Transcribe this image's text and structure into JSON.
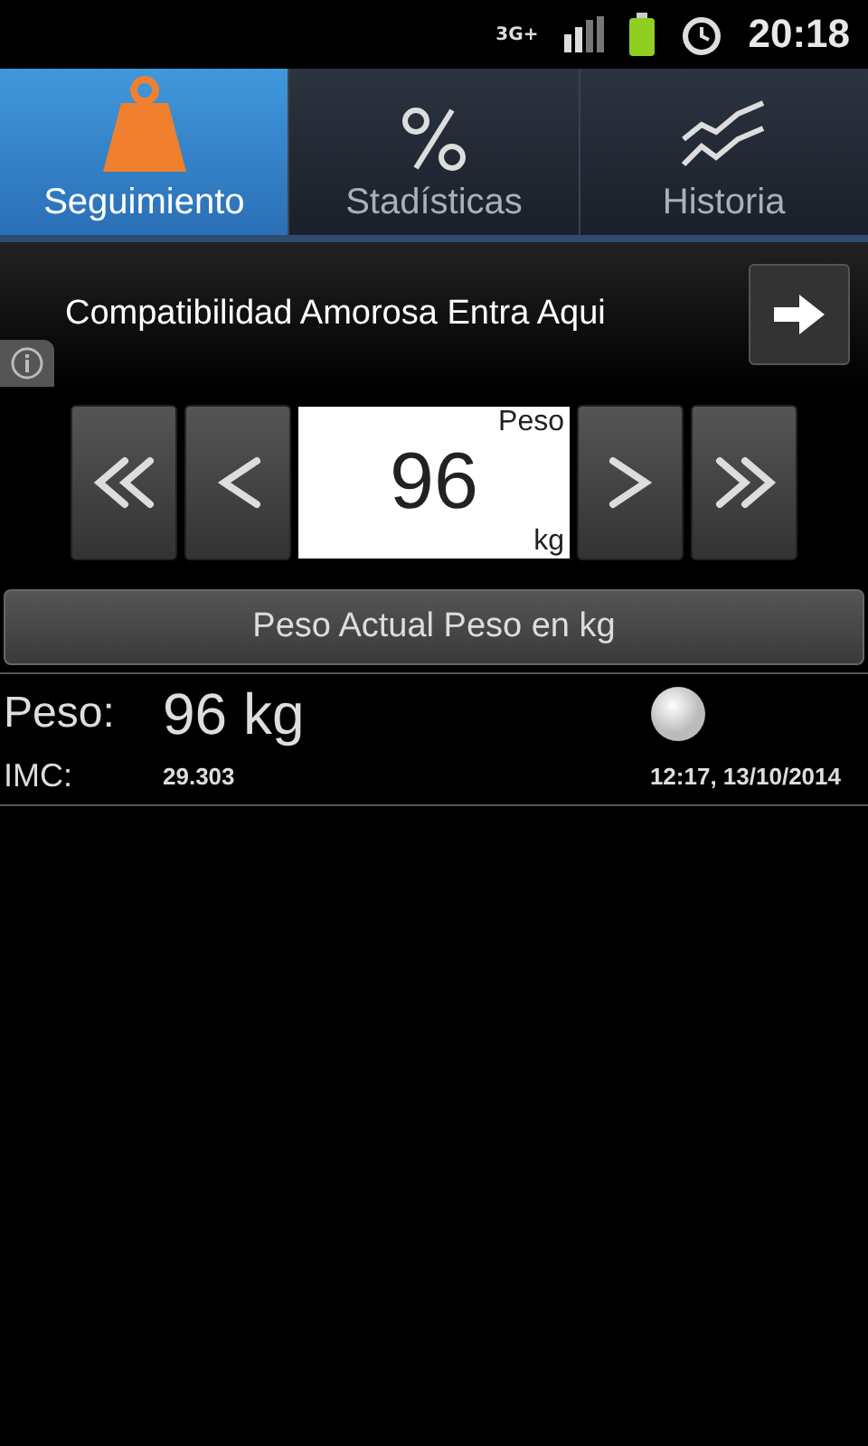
{
  "status_bar": {
    "network": "3G+",
    "time": "20:18"
  },
  "tabs": [
    {
      "label": "Seguimiento",
      "selected": true
    },
    {
      "label": "Stadísticas",
      "selected": false
    },
    {
      "label": "Historia",
      "selected": false
    }
  ],
  "ad": {
    "text": "Compatibilidad Amorosa Entra Aqui"
  },
  "stepper": {
    "label": "Peso",
    "value": "96",
    "unit": "kg"
  },
  "header_button": "Peso Actual Peso en kg",
  "entries": [
    {
      "weight_label": "Peso:",
      "weight": "96 kg",
      "bmi_label": "IMC:",
      "bmi": "29.303",
      "timestamp": "12:17, 13/10/2014"
    }
  ]
}
